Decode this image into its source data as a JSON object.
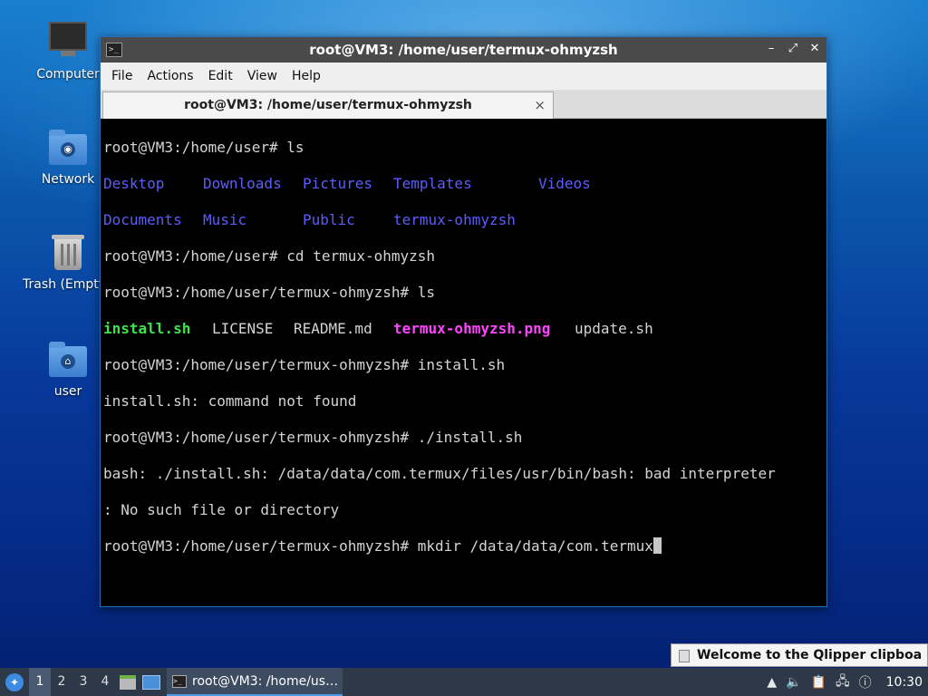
{
  "desktop": {
    "icons": [
      {
        "label": "Computer"
      },
      {
        "label": "Network"
      },
      {
        "label": "Trash (Empty)"
      },
      {
        "label": "user"
      }
    ]
  },
  "window": {
    "title": "root@VM3: /home/user/termux-ohmyzsh",
    "menu": [
      "File",
      "Actions",
      "Edit",
      "View",
      "Help"
    ],
    "tab_label": "root@VM3: /home/user/termux-ohmyzsh",
    "tab_close": "×",
    "controls": {
      "minimize": "–",
      "maximize": "⤢",
      "close": "✕"
    }
  },
  "terminal": {
    "lines": {
      "l1": "root@VM3:/home/user# ls",
      "l2": {
        "a": "Desktop",
        "b": "Downloads",
        "c": "Pictures",
        "d": "Templates",
        "e": "Videos"
      },
      "l3": {
        "a": "Documents",
        "b": "Music",
        "c": "Public",
        "d": "termux-ohmyzsh"
      },
      "l4": "root@VM3:/home/user# cd termux-ohmyzsh",
      "l5": "root@VM3:/home/user/termux-ohmyzsh# ls",
      "l6": {
        "a": "install.sh",
        "b": "LICENSE",
        "c": "README.md",
        "d": "termux-ohmyzsh.png",
        "e": "update.sh"
      },
      "l7": "root@VM3:/home/user/termux-ohmyzsh# install.sh",
      "l8": "install.sh: command not found",
      "l9": "root@VM3:/home/user/termux-ohmyzsh# ./install.sh",
      "l10": "bash: ./install.sh: /data/data/com.termux/files/usr/bin/bash: bad interpreter",
      "l11": ": No such file or directory",
      "l12": "root@VM3:/home/user/termux-ohmyzsh# mkdir /data/data/com.termux"
    },
    "colors": {
      "directory": "#5c5cff",
      "executable": "#3ee34b",
      "image": "#ff44ff"
    }
  },
  "notification": {
    "text": "Welcome to the Qlipper clipboa"
  },
  "taskbar": {
    "workspaces": [
      "1",
      "2",
      "3",
      "4"
    ],
    "active_workspace": "1",
    "task_label": "root@VM3: /home/us…",
    "clock": "10:30",
    "tray_icons": [
      "arrow-up-icon",
      "volume-icon",
      "clipboard-icon",
      "network-icon",
      "update-icon"
    ]
  }
}
